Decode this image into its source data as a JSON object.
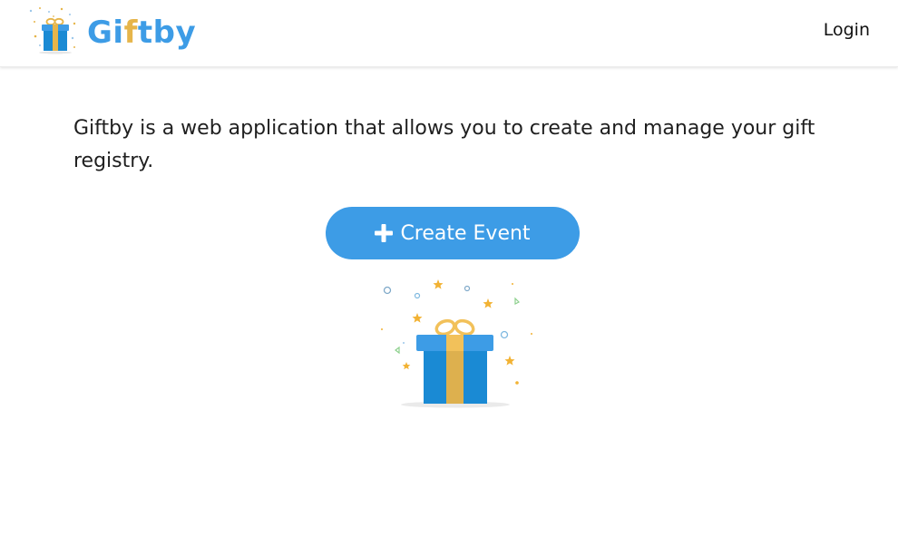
{
  "header": {
    "brand": {
      "part1": "Gi",
      "part2": "f",
      "part3": "tby",
      "icon": "gift-icon"
    },
    "login_label": "Login"
  },
  "main": {
    "intro_text": "Giftby is a web application that allows you to create and manage your gift registry.",
    "create_button": {
      "label": "Create Event",
      "icon": "plus-icon"
    },
    "illustration": "gift-box-confetti-illustration"
  },
  "colors": {
    "brand_blue": "#3d9ce6",
    "brand_gold": "#e6b54a",
    "gift_blue": "#1a8ad4",
    "ribbon_gold": "#ddb04e",
    "button_text": "#ffffff"
  }
}
